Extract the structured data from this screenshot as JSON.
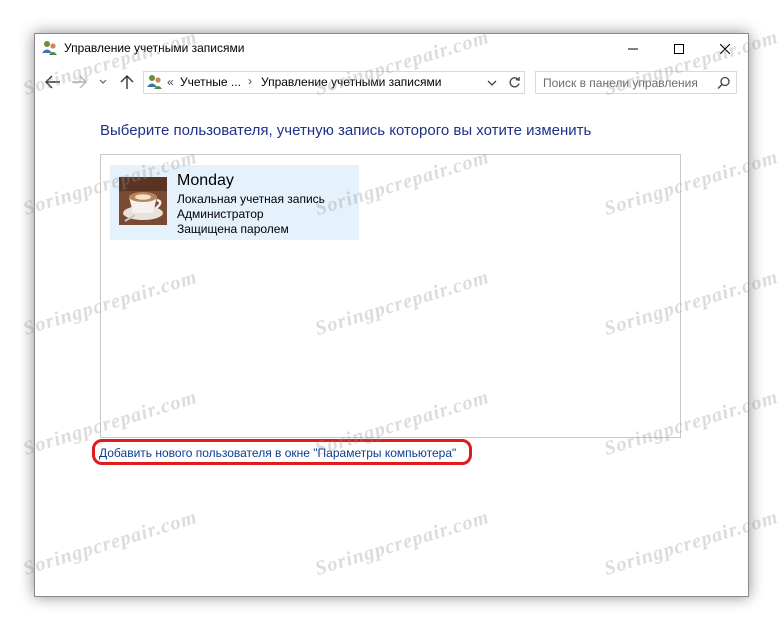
{
  "window": {
    "title": "Управление учетными записями",
    "buttons": {
      "minimize": "minimize",
      "maximize": "maximize",
      "close": "close"
    }
  },
  "navigation": {
    "address": {
      "overflow": "«",
      "crumbs": [
        "Учетные ...",
        "Управление учетными записями"
      ],
      "separator": "›"
    },
    "search": {
      "placeholder": "Поиск в панели управления"
    }
  },
  "main": {
    "heading": "Выберите пользователя, учетную запись которого вы хотите изменить",
    "users": [
      {
        "name": "Monday",
        "lines": [
          "Локальная учетная запись",
          "Администратор",
          "Защищена паролем"
        ]
      }
    ],
    "add_user_link": "Добавить нового пользователя в окне \"Параметры компьютера\""
  },
  "watermark": {
    "text": "Soringpcrepair.com"
  },
  "colors": {
    "heading": "#1e3287",
    "link": "#0b3d91",
    "tile_bg": "#e5f1fb",
    "highlight": "#e01b1b"
  }
}
